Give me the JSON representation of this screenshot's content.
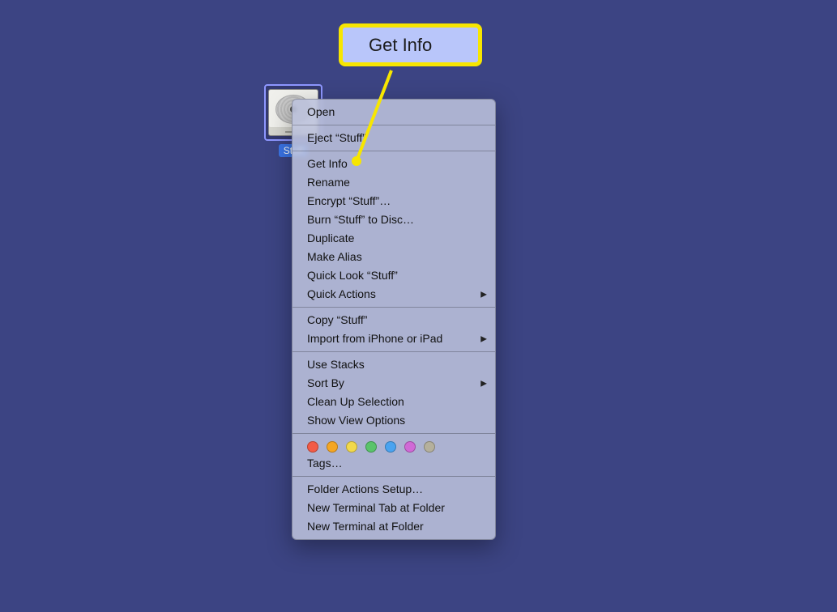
{
  "disk": {
    "label": "Stuff"
  },
  "callout": {
    "text": "Get Info"
  },
  "menu": {
    "groups": [
      [
        {
          "label": "Open"
        }
      ],
      [
        {
          "label": "Eject “Stuff”"
        }
      ],
      [
        {
          "label": "Get Info"
        },
        {
          "label": "Rename"
        },
        {
          "label": "Encrypt “Stuff”…"
        },
        {
          "label": "Burn “Stuff” to Disc…"
        },
        {
          "label": "Duplicate"
        },
        {
          "label": "Make Alias"
        },
        {
          "label": "Quick Look “Stuff”"
        },
        {
          "label": "Quick Actions",
          "submenu": true
        }
      ],
      [
        {
          "label": "Copy “Stuff”"
        },
        {
          "label": "Import from iPhone or iPad",
          "submenu": true
        }
      ],
      [
        {
          "label": "Use Stacks"
        },
        {
          "label": "Sort By",
          "submenu": true
        },
        {
          "label": "Clean Up Selection"
        },
        {
          "label": "Show View Options"
        }
      ],
      [
        {
          "tags": [
            "#f35b46",
            "#f5a623",
            "#f2d94b",
            "#5ac46b",
            "#4aa3f0",
            "#d069d6",
            "#b5b09c"
          ]
        },
        {
          "label": "Tags…"
        }
      ],
      [
        {
          "label": "Folder Actions Setup…"
        },
        {
          "label": "New Terminal Tab at Folder"
        },
        {
          "label": "New Terminal at Folder"
        }
      ]
    ]
  }
}
